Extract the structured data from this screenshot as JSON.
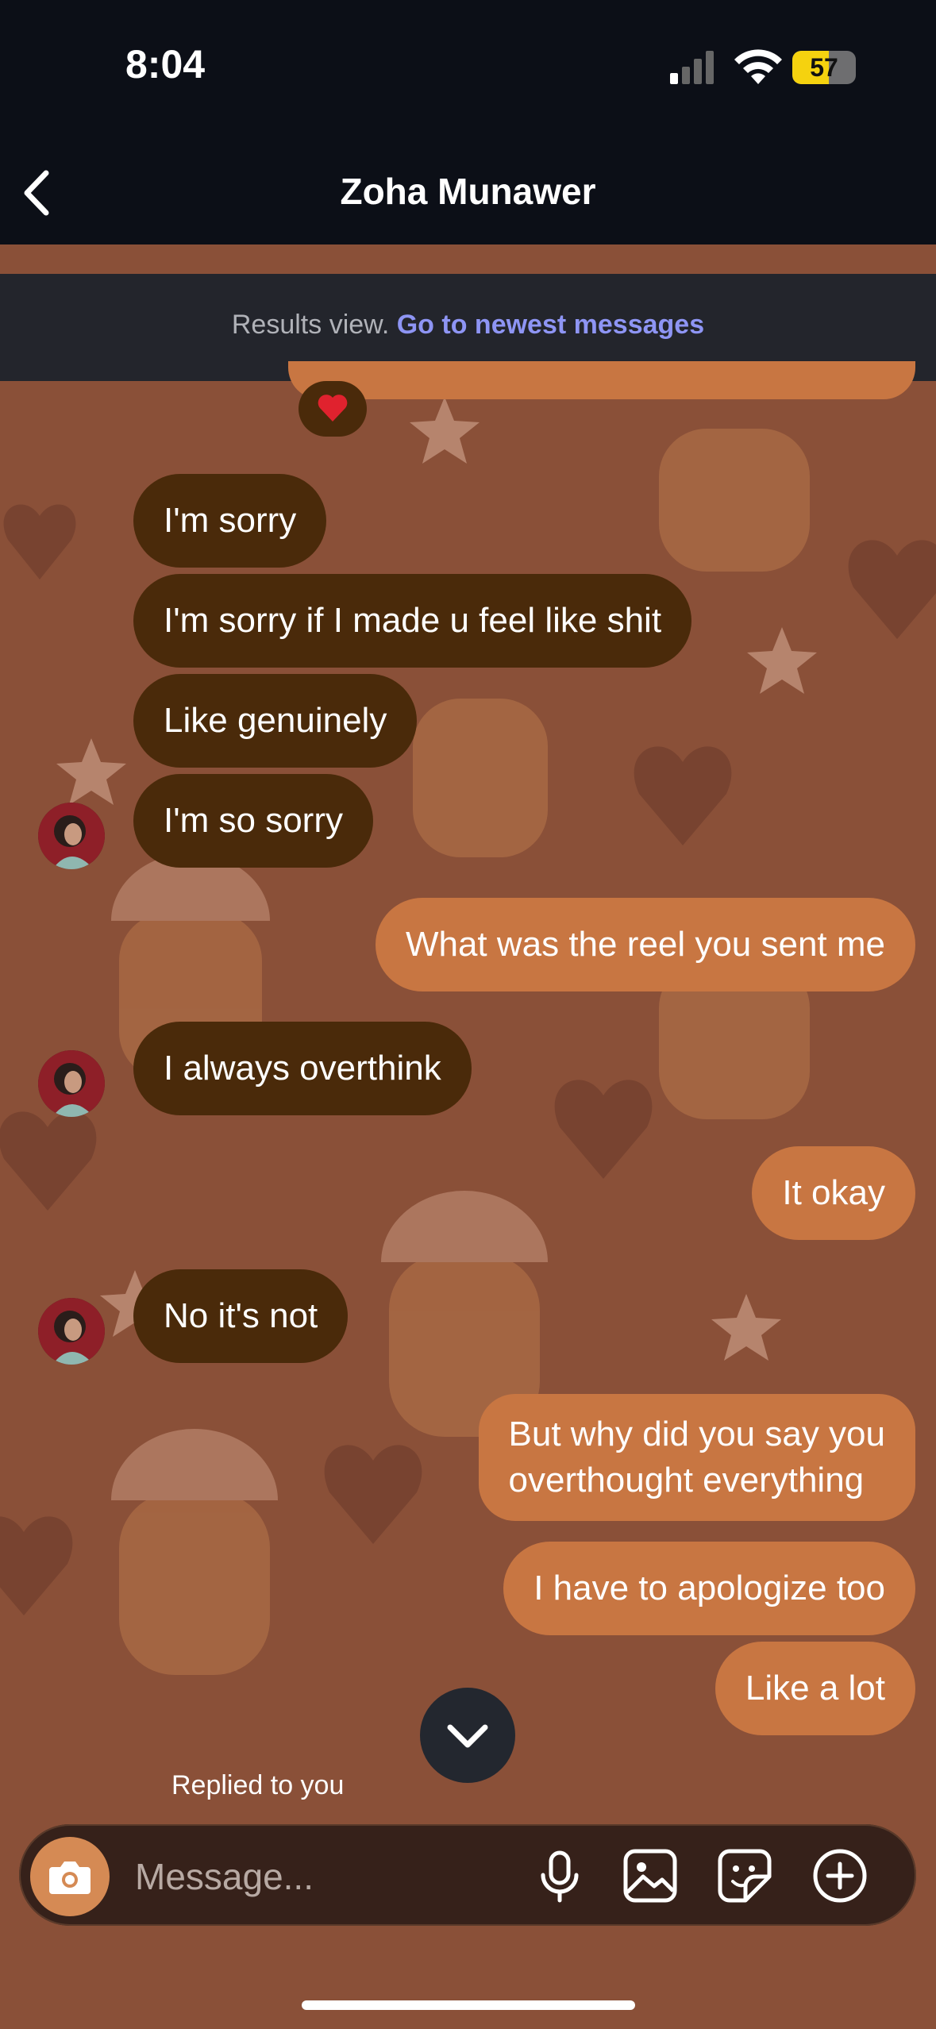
{
  "status_bar": {
    "time": "8:04",
    "battery_percent": "57",
    "battery_level": 0.57
  },
  "header": {
    "title": "Zoha Munawer",
    "back_icon": "chevron-left-icon"
  },
  "results_banner": {
    "prefix": "Results view.",
    "link": "Go to newest messages"
  },
  "reaction": {
    "emoji": "❤️"
  },
  "messages": [
    {
      "from": "them",
      "text": "I'm sorry"
    },
    {
      "from": "them",
      "text": "I'm sorry if I made u feel like shit"
    },
    {
      "from": "them",
      "text": "Like genuinely"
    },
    {
      "from": "them",
      "text": "I'm so sorry"
    },
    {
      "from": "me",
      "text": "What was the reel you sent me"
    },
    {
      "from": "them",
      "text": "I always overthink"
    },
    {
      "from": "me",
      "text": "It okay"
    },
    {
      "from": "them",
      "text": "No it's not"
    },
    {
      "from": "me",
      "text": "But why did you say you"
    },
    {
      "from": "me",
      "text": "overthought everything"
    },
    {
      "from": "me",
      "text": "I have to apologize too"
    },
    {
      "from": "me",
      "text": "Like a lot"
    }
  ],
  "replied_label": "Replied to you",
  "composer": {
    "placeholder": "Message...",
    "icons": [
      "camera-icon",
      "microphone-icon",
      "gallery-icon",
      "sticker-icon",
      "plus-icon"
    ]
  },
  "colors": {
    "incoming_bubble": "#4a2a0a",
    "outgoing_bubble": "#c87642",
    "background": "#8a5038",
    "link": "#8e95f4"
  }
}
